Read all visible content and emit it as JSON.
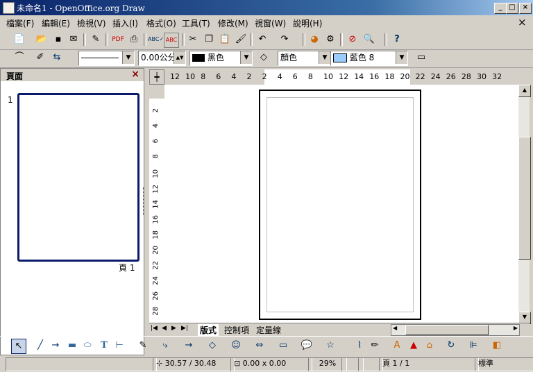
{
  "window": {
    "title": "未命名1 - OpenOffice.org Draw",
    "close_doc": "×"
  },
  "menu": [
    "檔案(F)",
    "編輯(E)",
    "檢視(V)",
    "插入(I)",
    "格式(O)",
    "工具(T)",
    "修改(M)",
    "視窗(W)",
    "說明(H)"
  ],
  "line_toolbar": {
    "line_width": "0.00公分",
    "line_color": "黑色",
    "area_style": "顏色",
    "area_color": "藍色 8",
    "colors": {
      "line_swatch": "#000000",
      "area_swatch": "#99ccff"
    }
  },
  "pages_panel": {
    "title": "頁面",
    "close": "×",
    "page_number": "1",
    "page_label": "頁 1"
  },
  "ruler": {
    "horizontal": [
      "12",
      "10",
      "8",
      "6",
      "4",
      "2",
      "2",
      "4",
      "6",
      "8",
      "10",
      "12",
      "14",
      "16",
      "18",
      "20",
      "22",
      "24",
      "26",
      "28",
      "30",
      "32"
    ],
    "vertical": [
      "2",
      "4",
      "6",
      "8",
      "10",
      "12",
      "14",
      "16",
      "18",
      "20",
      "22",
      "24",
      "26",
      "28"
    ]
  },
  "tabs": [
    "版式",
    "控制項",
    "定量線"
  ],
  "status": {
    "position": "30.57 / 30.48",
    "size": "0.00 x 0.00",
    "zoom": "29%",
    "page": "頁 1 / 1",
    "style": "標準"
  },
  "icons": [
    "new-icon",
    "open-icon",
    "save-icon",
    "email-icon",
    "edit-icon",
    "pdf-icon",
    "print-icon",
    "spellcheck-icon",
    "autospell-icon",
    "cut-icon",
    "copy-icon",
    "paste-icon",
    "format-paintbrush-icon",
    "undo-icon",
    "redo-icon",
    "chart-icon",
    "navigator-icon",
    "zoom-icon",
    "help-icon"
  ]
}
